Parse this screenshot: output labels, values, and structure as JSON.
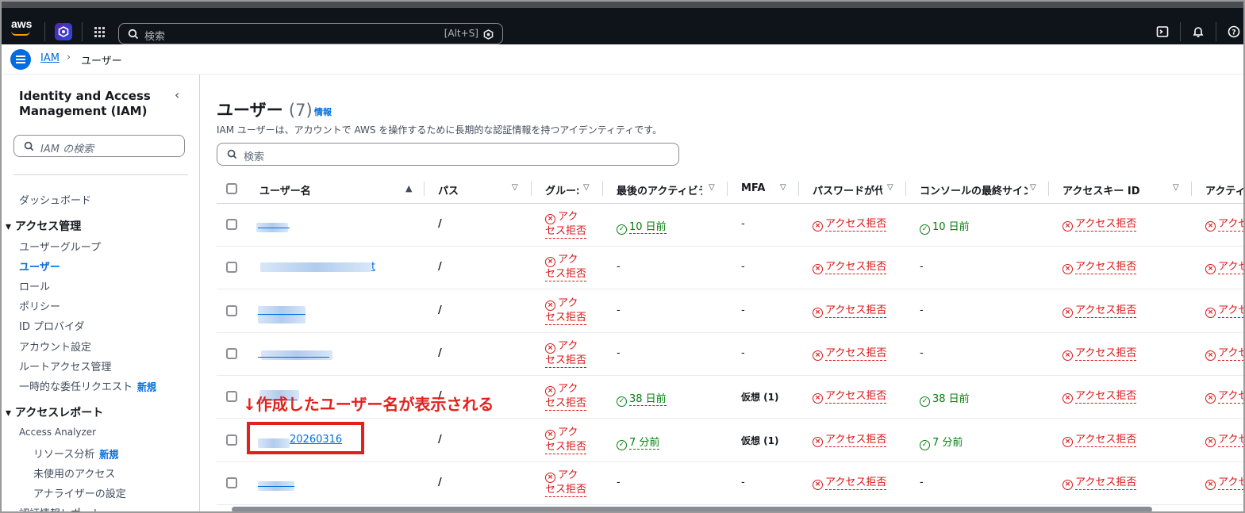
{
  "topbar": {
    "logo": "aws",
    "search_placeholder": "検索",
    "search_shortcut": "[Alt+S]"
  },
  "breadcrumb": {
    "root": "IAM",
    "separator": "›",
    "current": "ユーザー"
  },
  "sidebar": {
    "title": "Identity and Access Management (IAM)",
    "search_placeholder": "IAM の検索",
    "dashboard": "ダッシュボード",
    "access_mgmt": "アクセス管理",
    "items": [
      "ユーザーグループ",
      "ユーザー",
      "ロール",
      "ポリシー",
      "ID プロバイダ",
      "アカウント設定",
      "ルートアクセス管理"
    ],
    "temp_request": "一時的な委任リクエスト",
    "new_badge": "新規",
    "access_reports": "アクセスレポート",
    "access_analyzer": "Access Analyzer",
    "resource_analysis": "リソース分析",
    "unused_access": "未使用のアクセス",
    "analyzer_settings": "アナライザーの設定",
    "cred_report": "認証情報レポート"
  },
  "main": {
    "title": "ユーザー",
    "count": "(7)",
    "info": "情報",
    "description": "IAM ユーザーは、アカウントで AWS を操作するために長期的な認証情報を持つアイデンティティです。",
    "search_placeholder": "検索",
    "columns": [
      "ユーザー名",
      "パス",
      "グルー:",
      "最後のアクティビラ",
      "MFA",
      "パスワードが代",
      "コンソールの最終サイン",
      "アクセスキー ID",
      "アクティ"
    ],
    "denied_short_1": "アク",
    "denied_short_2": "セス拒否",
    "denied": "アクセス拒否",
    "denied_cut": "アクセ",
    "rows": [
      {
        "user": "",
        "path": "/",
        "activity": "10 日前",
        "mfa": "-",
        "console": "10 日前"
      },
      {
        "user": "t",
        "path": "/",
        "activity": "-",
        "mfa": "-",
        "console": "-"
      },
      {
        "user": "",
        "path": "/",
        "activity": "-",
        "mfa": "-",
        "console": "-"
      },
      {
        "user": "",
        "path": "/",
        "activity": "-",
        "mfa": "-",
        "console": "-"
      },
      {
        "user": "",
        "path": "/",
        "activity": "38 日前",
        "mfa": "仮想 (1)",
        "console": "38 日前"
      },
      {
        "user": "20260316",
        "path": "/",
        "activity": "7 分前",
        "mfa": "仮想 (1)",
        "console": "7 分前"
      },
      {
        "user": "",
        "path": "/",
        "activity": "-",
        "mfa": "-",
        "console": "-"
      }
    ]
  },
  "annotation": {
    "text": "↓作成したユーザー名が表示される"
  },
  "colors": {
    "accent": "#006ce0",
    "error": "#d91515",
    "success": "#037f0c",
    "annotation": "#e3211c",
    "topbar": "#0f141a"
  }
}
